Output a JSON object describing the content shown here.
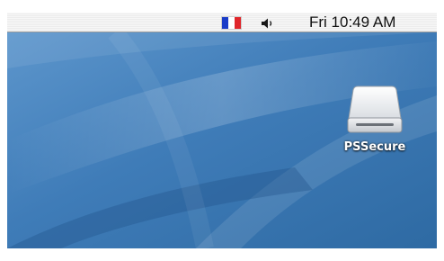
{
  "menubar": {
    "input_menu": {
      "icon": "french-flag-icon",
      "colors": [
        "#1a3cc8",
        "#ffffff",
        "#e0262b"
      ]
    },
    "volume_icon": "speaker-icon",
    "clock": "Fri 10:49 AM"
  },
  "desktop": {
    "icons": [
      {
        "label": "PSSecure",
        "icon": "external-drive-icon"
      }
    ],
    "wallpaper_colors": {
      "base": "#3f7cb8",
      "light": "#6fa6d6",
      "dark": "#2f5f94"
    }
  }
}
